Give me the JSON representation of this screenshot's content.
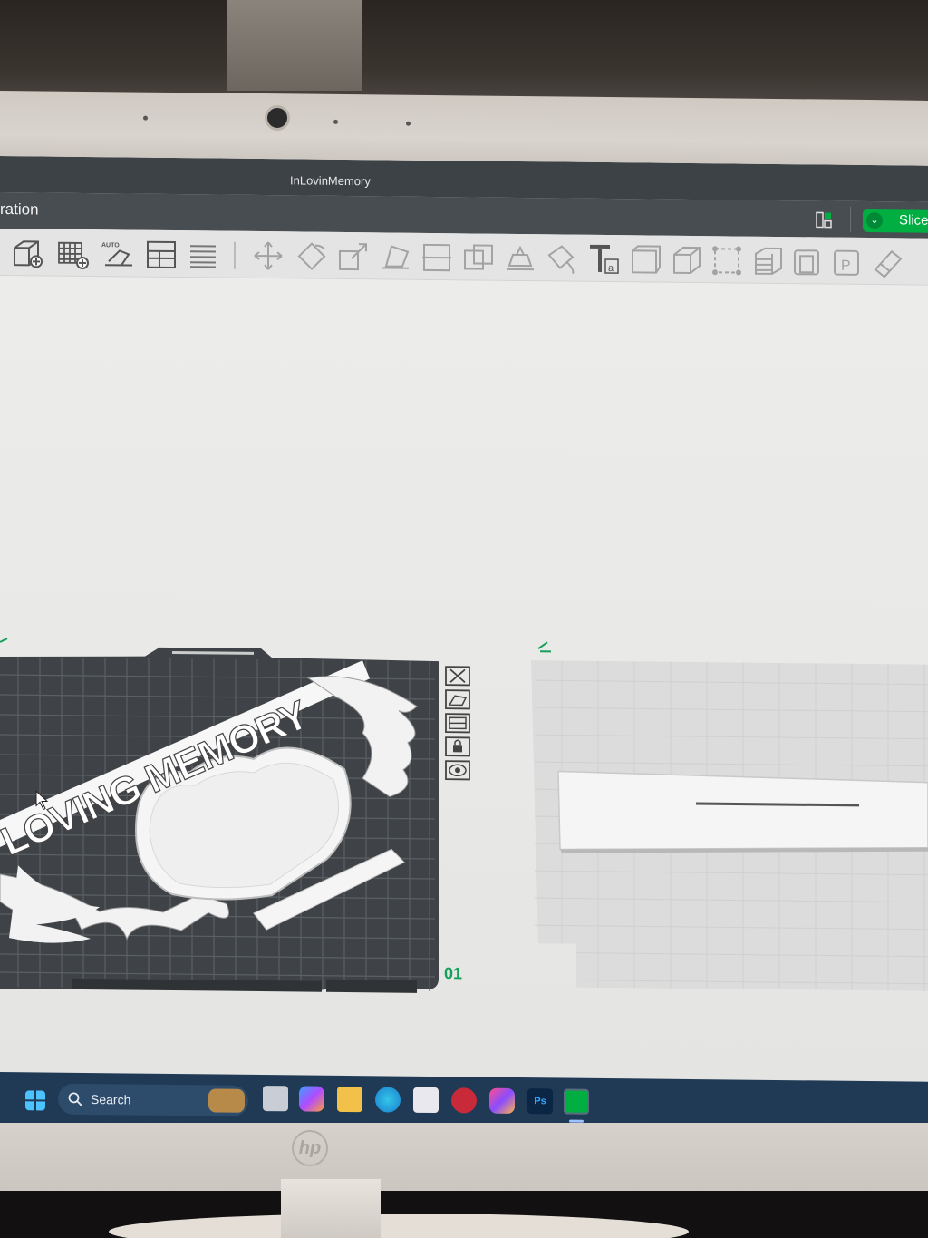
{
  "window": {
    "title": "InLovinMemory"
  },
  "menubar": {
    "tab_label": "ration",
    "slice_label": "Slice"
  },
  "toolbar": {
    "tools": [
      "add-object-icon",
      "add-plate-icon",
      "auto-orient-icon",
      "arrange-icon",
      "layers-icon",
      "move-icon",
      "rotate-icon",
      "scale-icon",
      "lay-on-face-icon",
      "cut-icon",
      "boolean-icon",
      "support-paint-icon",
      "seam-paint-icon",
      "text-icon",
      "mesh-icon",
      "shell-icon",
      "measure-icon",
      "assembly-icon",
      "variable-layer-icon",
      "paint-icon",
      "brim-ears-icon"
    ]
  },
  "viewport": {
    "model_text": "LOVING MEMORY",
    "plate_1": {
      "number": "01",
      "side_tools": [
        "close-icon",
        "orient-icon",
        "arrange-icon",
        "lock-icon",
        "settings-icon"
      ]
    },
    "plate_2": {}
  },
  "taskbar": {
    "search_label": "Search",
    "apps": [
      "start-icon",
      "widgets-icon",
      "task-view-icon",
      "copilot-icon",
      "file-explorer-icon",
      "edge-icon",
      "store-icon",
      "app-icon",
      "creative-cloud-icon",
      "photoshop-icon",
      "bambu-studio-icon"
    ]
  },
  "monitor": {
    "brand": "hp"
  },
  "colors": {
    "accent": "#00ae42",
    "titlebar": "#3d4246",
    "plate": "#3f4347",
    "model": "#f2f2f2"
  }
}
